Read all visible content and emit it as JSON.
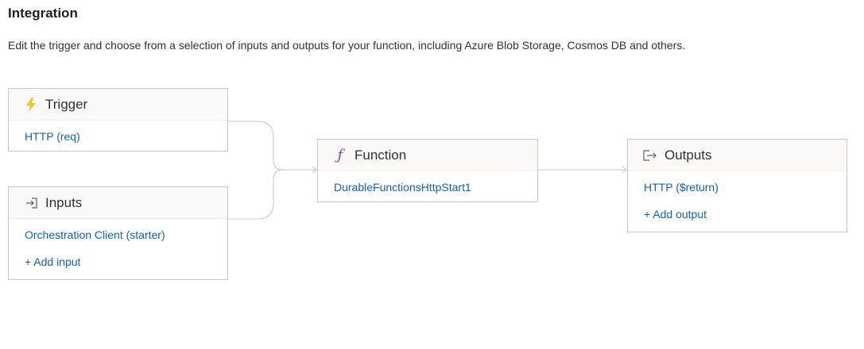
{
  "page": {
    "title": "Integration",
    "description": "Edit the trigger and choose from a selection of inputs and outputs for your function, including Azure Blob Storage, Cosmos DB and others."
  },
  "trigger": {
    "title": "Trigger",
    "icon": "lightning-bolt-icon",
    "items": [
      "HTTP (req)"
    ]
  },
  "inputs": {
    "title": "Inputs",
    "icon": "input-arrow-icon",
    "items": [
      "Orchestration Client (starter)"
    ],
    "add_label": "+ Add input"
  },
  "function": {
    "title": "Function",
    "icon": "function-icon",
    "glyph": "ƒ",
    "items": [
      "DurableFunctionsHttpStart1"
    ]
  },
  "outputs": {
    "title": "Outputs",
    "icon": "output-arrow-icon",
    "items": [
      "HTTP ($return)"
    ],
    "add_label": "+ Add output"
  },
  "colors": {
    "link": "#0f5fbf",
    "bolt": "#fcc419",
    "function_icon": "#8b3fa8",
    "connector": "#c8c6c4"
  }
}
